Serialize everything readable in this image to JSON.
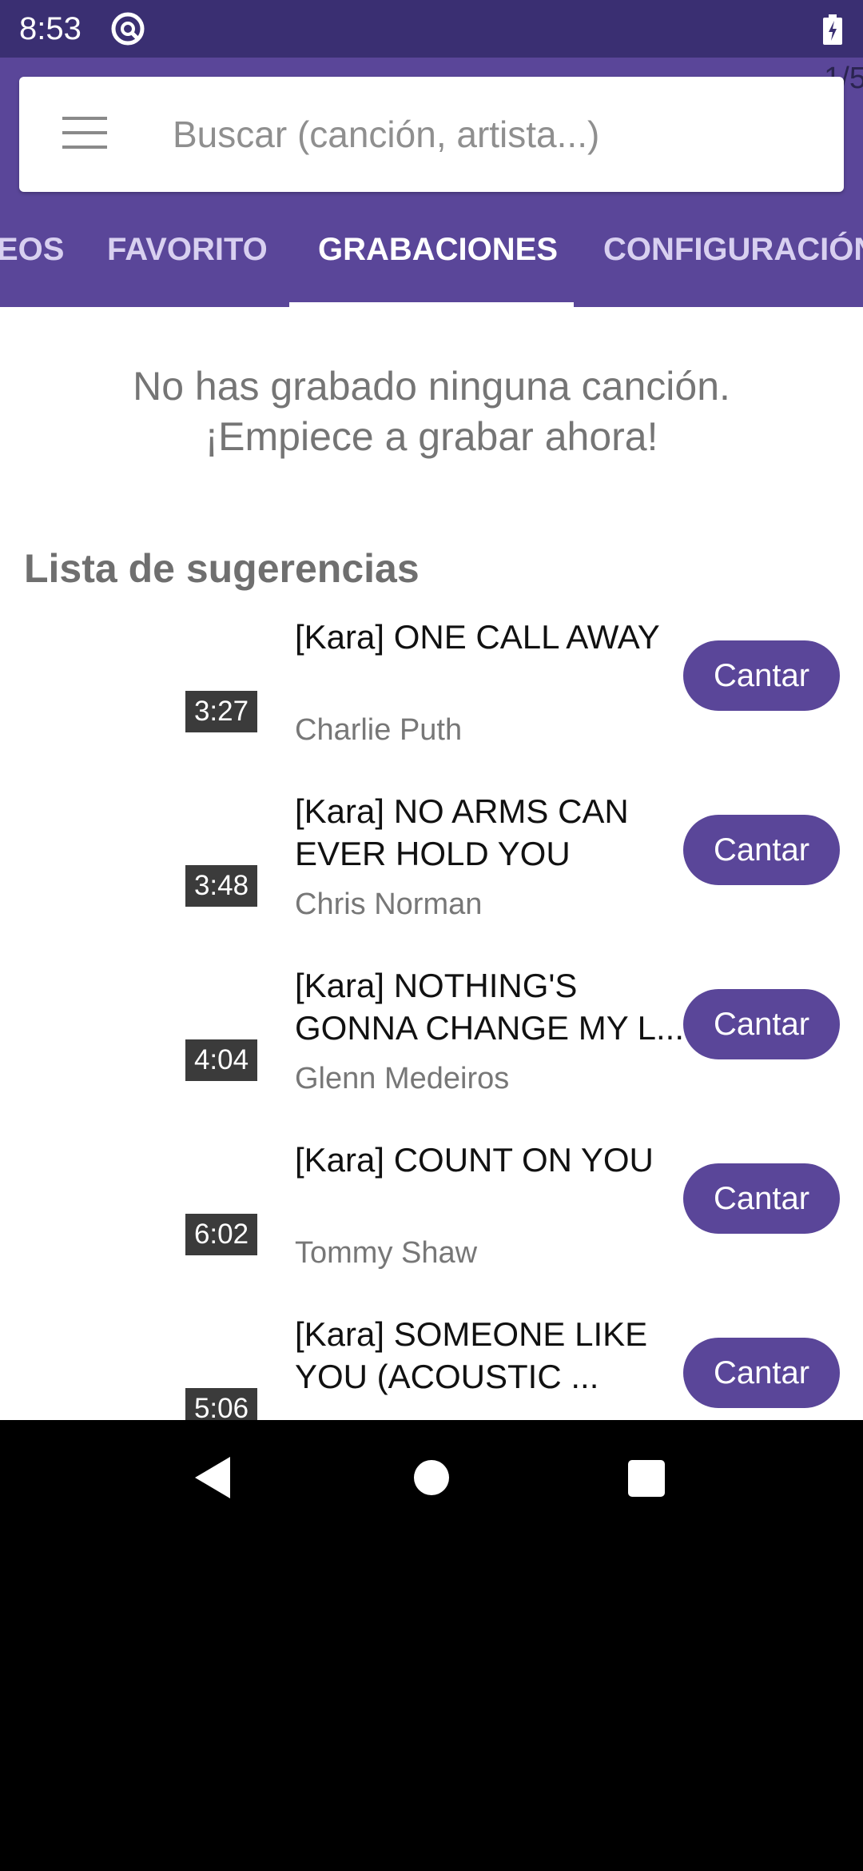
{
  "status_bar": {
    "time": "8:53",
    "app_icon": "podcast-circle-icon",
    "battery_icon": "battery-charging-icon"
  },
  "header": {
    "page_indicator": "1/5",
    "search": {
      "placeholder": "Buscar (canción, artista...)",
      "value": ""
    },
    "menu_icon": "hamburger-menu-icon",
    "tabs": [
      {
        "label": "EOS"
      },
      {
        "label": "FAVORITO"
      },
      {
        "label": "GRABACIONES",
        "active": true
      },
      {
        "label": "CONFIGURACIÓN"
      }
    ]
  },
  "main": {
    "empty_message_line1": "No has grabado ninguna canción.",
    "empty_message_line2": "¡Empiece a grabar ahora!",
    "suggestions_title": "Lista de sugerencias",
    "songs": [
      {
        "title": "[Kara] ONE CALL AWAY",
        "artist": "Charlie Puth",
        "duration": "3:27",
        "button": "Cantar"
      },
      {
        "title": "[Kara] NO ARMS CAN EVER HOLD YOU",
        "artist": "Chris Norman",
        "duration": "3:48",
        "button": "Cantar"
      },
      {
        "title": "[Kara] NOTHING'S GONNA CHANGE MY L...",
        "artist": "Glenn Medeiros",
        "duration": "4:04",
        "button": "Cantar"
      },
      {
        "title": "[Kara] COUNT ON YOU",
        "artist": "Tommy Shaw",
        "duration": "6:02",
        "button": "Cantar"
      },
      {
        "title": "[Kara] SOMEONE LIKE YOU (ACOUSTIC ...",
        "artist": "",
        "duration": "5:06",
        "button": "Cantar"
      }
    ]
  },
  "colors": {
    "primary": "#5a4699",
    "status_bar": "#3a2f72",
    "tab_inactive": "#d8d0f0",
    "text_muted": "#757575"
  },
  "nav_bar": {
    "back_icon": "back-triangle-icon",
    "home_icon": "home-circle-icon",
    "recents_icon": "recents-square-icon"
  }
}
